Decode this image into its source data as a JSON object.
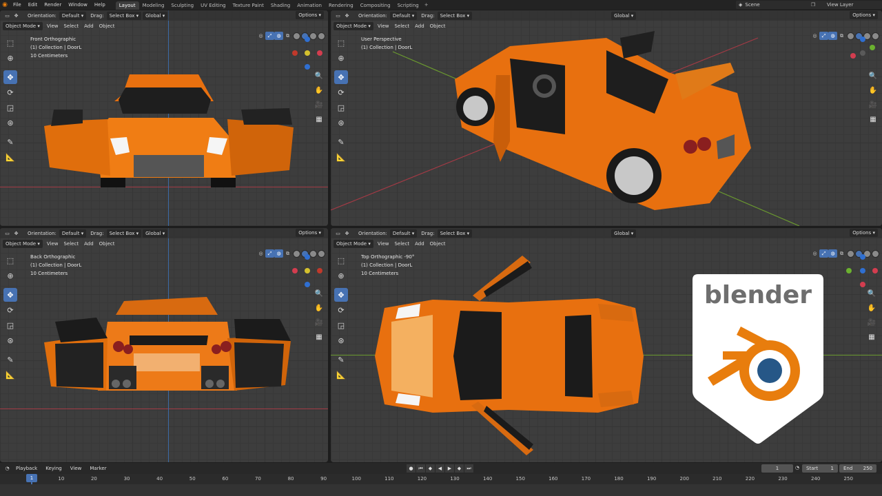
{
  "topbar": {
    "menus": [
      "File",
      "Edit",
      "Render",
      "Window",
      "Help"
    ],
    "workspaces": [
      "Layout",
      "Modeling",
      "Sculpting",
      "UV Editing",
      "Texture Paint",
      "Shading",
      "Animation",
      "Rendering",
      "Compositing",
      "Scripting"
    ],
    "active_workspace": "Layout",
    "plus": "+",
    "scene": "Scene",
    "view_layer": "View Layer"
  },
  "header": {
    "orientation_label": "Orientation:",
    "orientation_value": "Default",
    "drag_label": "Drag:",
    "drag_value": "Select Box",
    "transform_value": "Global",
    "options": "Options",
    "mode": "Object Mode",
    "menus": [
      "View",
      "Select",
      "Add",
      "Object"
    ]
  },
  "viewports": {
    "front": {
      "title": "Front Orthographic",
      "collection": "(1) Collection | DoorL",
      "scale": "10 Centimeters"
    },
    "persp": {
      "title": "User Perspective",
      "collection": "(1) Collection | DoorL"
    },
    "back": {
      "title": "Back Orthographic",
      "collection": "(1) Collection | DoorL",
      "scale": "10 Centimeters"
    },
    "top": {
      "title": "Top Orthographic -90°",
      "collection": "(1) Collection | DoorL",
      "scale": "10 Centimeters"
    }
  },
  "timeline": {
    "menus": [
      "Playback",
      "Keying",
      "View",
      "Marker"
    ],
    "current_frame": "1",
    "start_label": "Start",
    "start_value": "1",
    "end_label": "End",
    "end_value": "250",
    "frame_field": "1",
    "ticks": [
      "1",
      "10",
      "20",
      "30",
      "40",
      "50",
      "60",
      "70",
      "80",
      "90",
      "100",
      "110",
      "120",
      "130",
      "140",
      "150",
      "160",
      "170",
      "180",
      "190",
      "200",
      "210",
      "220",
      "230",
      "240",
      "250"
    ]
  },
  "logo": {
    "text": "blender"
  },
  "colors": {
    "car_orange": "#e8700f",
    "axis_red": "#c0392b",
    "axis_green": "#6bb12f",
    "axis_blue": "#2f6fd1",
    "select_blue": "#4772b3",
    "logo_orange": "#e87d0d",
    "logo_blue": "#265787"
  }
}
